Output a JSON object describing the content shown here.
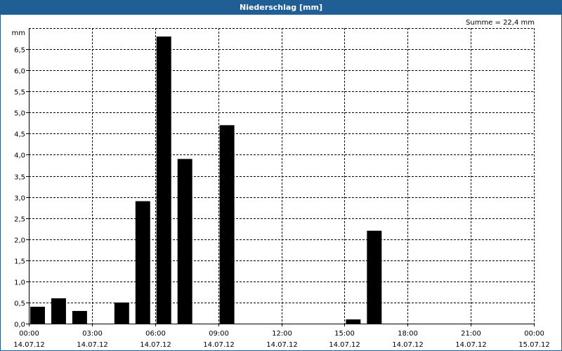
{
  "window": {
    "title": "Niederschlag [mm]"
  },
  "annotation": {
    "summe": "Summe = 22,4 mm"
  },
  "chart_data": {
    "type": "bar",
    "title": "Niederschlag [mm]",
    "ylabel": "mm",
    "xlabel": "",
    "ylim": [
      0,
      7.0
    ],
    "xlim_hours": [
      0,
      24
    ],
    "y_ticks": [
      0,
      0.5,
      1.0,
      1.5,
      2.0,
      2.5,
      3.0,
      3.5,
      4.0,
      4.5,
      5.0,
      5.5,
      6.0,
      6.5
    ],
    "y_tick_labels": [
      "0,0",
      "0,5",
      "1,0",
      "1,5",
      "2,0",
      "2,5",
      "3,0",
      "3,5",
      "4,0",
      "4,5",
      "5,0",
      "5,5",
      "6,0",
      "6,5"
    ],
    "x_ticks": [
      {
        "hour": 0,
        "time": "00:00",
        "date": "14.07.12"
      },
      {
        "hour": 3,
        "time": "03:00",
        "date": "14.07.12"
      },
      {
        "hour": 6,
        "time": "06:00",
        "date": "14.07.12"
      },
      {
        "hour": 9,
        "time": "09:00",
        "date": "14.07.12"
      },
      {
        "hour": 12,
        "time": "12:00",
        "date": "14.07.12"
      },
      {
        "hour": 15,
        "time": "15:00",
        "date": "14.07.12"
      },
      {
        "hour": 18,
        "time": "18:00",
        "date": "14.07.12"
      },
      {
        "hour": 21,
        "time": "21:00",
        "date": "14.07.12"
      },
      {
        "hour": 24,
        "time": "00:00",
        "date": "15.07.12"
      }
    ],
    "grid": true,
    "color": "#000000",
    "bars": [
      {
        "hour": 0,
        "value": 0.4
      },
      {
        "hour": 1,
        "value": 0.6
      },
      {
        "hour": 2,
        "value": 0.3
      },
      {
        "hour": 4,
        "value": 0.5
      },
      {
        "hour": 5,
        "value": 2.9
      },
      {
        "hour": 6,
        "value": 6.8
      },
      {
        "hour": 7,
        "value": 3.9
      },
      {
        "hour": 9,
        "value": 4.7
      },
      {
        "hour": 15,
        "value": 0.1
      },
      {
        "hour": 16,
        "value": 2.2
      }
    ]
  }
}
